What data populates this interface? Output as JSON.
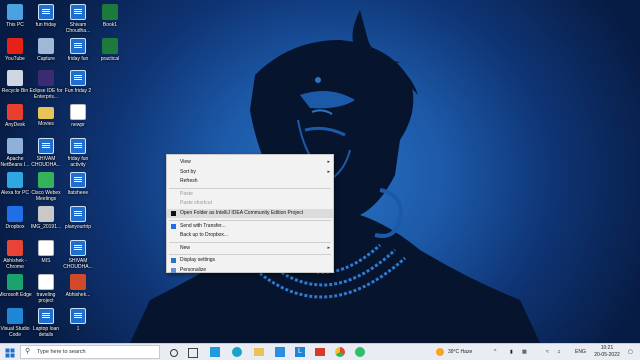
{
  "desktop_icons": [
    {
      "label": "This PC",
      "kind": "pc",
      "color": "#4aa3e0"
    },
    {
      "label": "fun friday",
      "kind": "doc",
      "color": "#1f6fd1"
    },
    {
      "label": "Shivam Choudha...",
      "kind": "doc",
      "color": "#1f6fd1"
    },
    {
      "label": "Book1",
      "kind": "sheet",
      "color": "#1e7a3c"
    },
    {
      "label": "YouTube",
      "kind": "app",
      "color": "#e62117"
    },
    {
      "label": "Capture",
      "kind": "image",
      "color": "#9fb8d8"
    },
    {
      "label": "friday fun",
      "kind": "doc",
      "color": "#1f6fd1"
    },
    {
      "label": "practical",
      "kind": "sheet",
      "color": "#1e7a3c"
    },
    {
      "label": "Recycle Bin",
      "kind": "bin",
      "color": "#cfd8e2"
    },
    {
      "label": "Eclipse IDE for Enterpris...",
      "kind": "app",
      "color": "#3b2b73"
    },
    {
      "label": "Fun friday 2",
      "kind": "doc",
      "color": "#1f6fd1"
    },
    {
      "label": "AnyDesk",
      "kind": "app",
      "color": "#e8402d"
    },
    {
      "label": "Movies",
      "kind": "folder",
      "color": "#e8c35a"
    },
    {
      "label": "newpr",
      "kind": "blank",
      "color": "#ffffff"
    },
    {
      "label": "Apache NetBeans I...",
      "kind": "app",
      "color": "#8fb1d9"
    },
    {
      "label": "SHIVAM CHOUDHA...",
      "kind": "doc",
      "color": "#1f6fd1"
    },
    {
      "label": "friday fun activity",
      "kind": "doc",
      "color": "#1f6fd1"
    },
    {
      "label": "Alexa for PC",
      "kind": "app",
      "color": "#2ea8e0"
    },
    {
      "label": "Cisco Webex Meetings",
      "kind": "app",
      "color": "#33b25a"
    },
    {
      "label": "ltatsheee",
      "kind": "doc",
      "color": "#1f6fd1"
    },
    {
      "label": "Dropbox",
      "kind": "app",
      "color": "#1f6fe6"
    },
    {
      "label": "IMG_20191...",
      "kind": "image",
      "color": "#c8c8c8"
    },
    {
      "label": "planyourtrip",
      "kind": "doc",
      "color": "#1f6fd1"
    },
    {
      "label": "Abhishek - Chrome",
      "kind": "app",
      "color": "#e84335"
    },
    {
      "label": "MIS",
      "kind": "blank",
      "color": "#ffffff"
    },
    {
      "label": "SHIVAM CHOUDHA...",
      "kind": "doc",
      "color": "#1f6fd1"
    },
    {
      "label": "Microsoft Edge",
      "kind": "app",
      "color": "#1aa36c"
    },
    {
      "label": "traveling project",
      "kind": "blank",
      "color": "#ffffff"
    },
    {
      "label": "Abhishek...",
      "kind": "app",
      "color": "#d04a2a"
    },
    {
      "label": "Visual Studio Code",
      "kind": "app",
      "color": "#1f86d6"
    },
    {
      "label": "Laptop loan details",
      "kind": "doc",
      "color": "#1f6fd1"
    },
    {
      "label": "1",
      "kind": "doc",
      "color": "#1f6fd1"
    }
  ],
  "context_menu": {
    "items": [
      {
        "label": "View",
        "submenu": true,
        "disabled": false
      },
      {
        "label": "Sort by",
        "submenu": true,
        "disabled": false
      },
      {
        "label": "Refresh",
        "submenu": false,
        "disabled": false
      },
      {
        "separator": true
      },
      {
        "label": "Paste",
        "submenu": false,
        "disabled": true
      },
      {
        "label": "Paste shortcut",
        "submenu": false,
        "disabled": true
      },
      {
        "label": "Open Folder as IntelliJ IDEA Community Edition Project",
        "submenu": false,
        "disabled": false,
        "icon": "intellij-icon",
        "highlighted": true
      },
      {
        "separator": true
      },
      {
        "label": "Send with Transfer...",
        "submenu": false,
        "disabled": false,
        "icon": "dropbox-icon"
      },
      {
        "label": "Back up to Dropbox...",
        "submenu": false,
        "disabled": false
      },
      {
        "separator": true
      },
      {
        "label": "New",
        "submenu": true,
        "disabled": false
      },
      {
        "separator": true
      },
      {
        "label": "Display settings",
        "submenu": false,
        "disabled": false,
        "icon": "display-icon"
      },
      {
        "label": "Personalize",
        "submenu": false,
        "disabled": false,
        "icon": "personalize-icon"
      }
    ]
  },
  "taskbar": {
    "search_placeholder": "Type here to search",
    "weather": "39°C  Haze",
    "language": "ENG",
    "time": "10:21",
    "date": "20-05-2022"
  }
}
